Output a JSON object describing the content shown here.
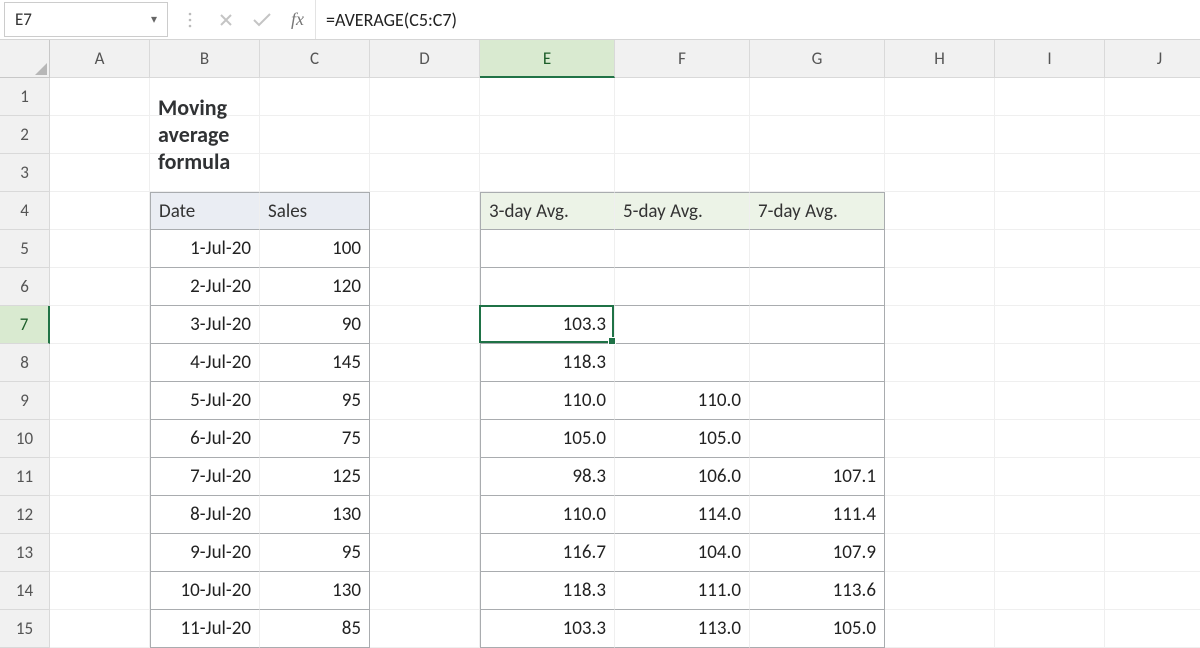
{
  "namebox": {
    "value": "E7"
  },
  "formula_bar": {
    "formula": "=AVERAGE(C5:C7)",
    "fx_label": "fx"
  },
  "columns": [
    "A",
    "B",
    "C",
    "D",
    "E",
    "F",
    "G",
    "H",
    "I",
    "J"
  ],
  "active": {
    "col": "E",
    "row": 7
  },
  "title": "Moving average formula",
  "headers_left": {
    "date": "Date",
    "sales": "Sales"
  },
  "headers_right": {
    "avg3": "3-day Avg.",
    "avg5": "5-day Avg.",
    "avg7": "7-day Avg."
  },
  "rows": [
    {
      "n": 5,
      "date": "1-Jul-20",
      "sales": "100",
      "a3": "",
      "a5": "",
      "a7": ""
    },
    {
      "n": 6,
      "date": "2-Jul-20",
      "sales": "120",
      "a3": "",
      "a5": "",
      "a7": ""
    },
    {
      "n": 7,
      "date": "3-Jul-20",
      "sales": "90",
      "a3": "103.3",
      "a5": "",
      "a7": ""
    },
    {
      "n": 8,
      "date": "4-Jul-20",
      "sales": "145",
      "a3": "118.3",
      "a5": "",
      "a7": ""
    },
    {
      "n": 9,
      "date": "5-Jul-20",
      "sales": "95",
      "a3": "110.0",
      "a5": "110.0",
      "a7": ""
    },
    {
      "n": 10,
      "date": "6-Jul-20",
      "sales": "75",
      "a3": "105.0",
      "a5": "105.0",
      "a7": ""
    },
    {
      "n": 11,
      "date": "7-Jul-20",
      "sales": "125",
      "a3": "98.3",
      "a5": "106.0",
      "a7": "107.1"
    },
    {
      "n": 12,
      "date": "8-Jul-20",
      "sales": "130",
      "a3": "110.0",
      "a5": "114.0",
      "a7": "111.4"
    },
    {
      "n": 13,
      "date": "9-Jul-20",
      "sales": "95",
      "a3": "116.7",
      "a5": "104.0",
      "a7": "107.9"
    },
    {
      "n": 14,
      "date": "10-Jul-20",
      "sales": "130",
      "a3": "118.3",
      "a5": "111.0",
      "a7": "113.6"
    },
    {
      "n": 15,
      "date": "11-Jul-20",
      "sales": "85",
      "a3": "103.3",
      "a5": "113.0",
      "a7": "105.0"
    }
  ]
}
